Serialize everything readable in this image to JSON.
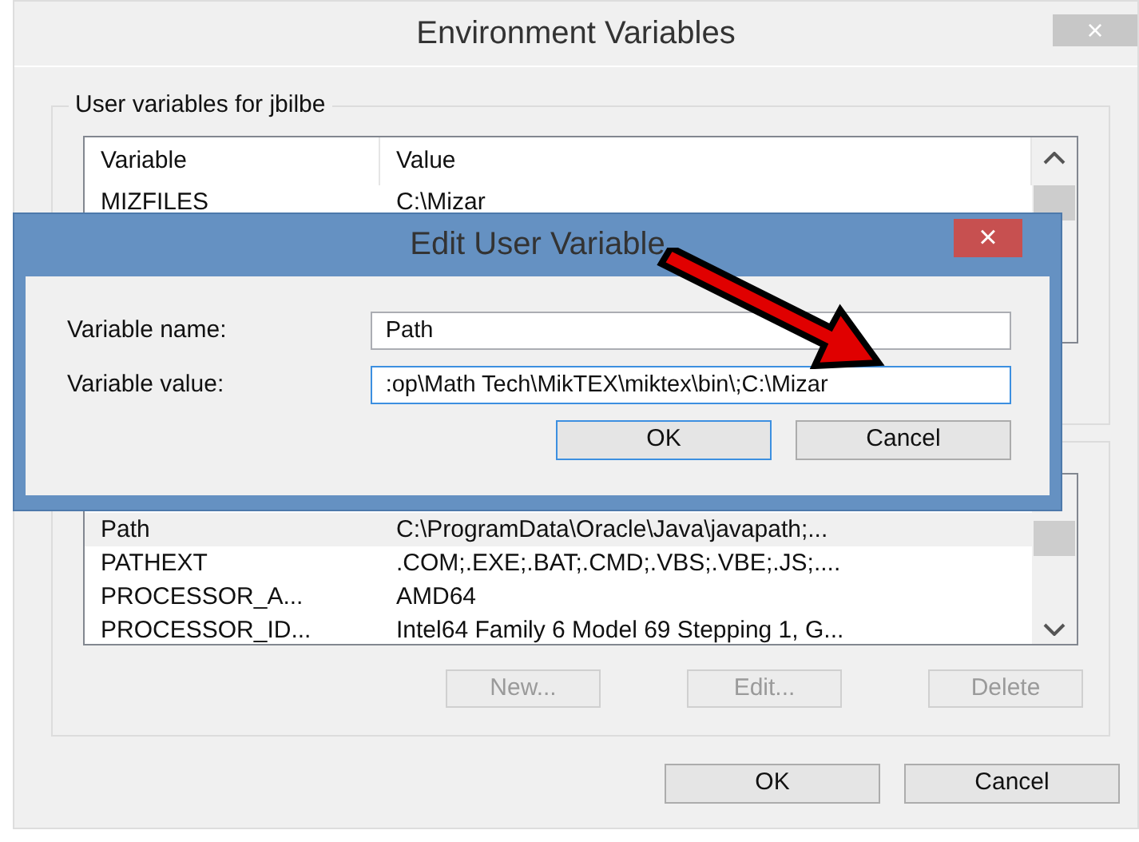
{
  "window": {
    "title": "Environment Variables",
    "close": "×"
  },
  "user_variables": {
    "label": "User variables for jbilbe",
    "columns": [
      "Variable",
      "Value"
    ],
    "rows": [
      {
        "variable": "MIZFILES",
        "value": "C:\\Mizar"
      }
    ]
  },
  "system_variables": {
    "rows": [
      {
        "variable": "Path",
        "value": "C:\\ProgramData\\Oracle\\Java\\javapath;...",
        "selected": true
      },
      {
        "variable": "PATHEXT",
        "value": ".COM;.EXE;.BAT;.CMD;.VBS;.VBE;.JS;....",
        "selected": false
      },
      {
        "variable": "PROCESSOR_A...",
        "value": "AMD64",
        "selected": false
      },
      {
        "variable": "PROCESSOR_ID...",
        "value": "Intel64 Family 6 Model 69 Stepping 1, G...",
        "selected": false
      }
    ],
    "buttons": [
      {
        "label": "New...",
        "disabled": true
      },
      {
        "label": "Edit...",
        "disabled": true
      },
      {
        "label": "Delete",
        "disabled": true
      }
    ]
  },
  "buttons": [
    {
      "label": "OK",
      "default": false
    },
    {
      "label": "Cancel",
      "default": false
    }
  ],
  "edit_dialog": {
    "title": "Edit User Variable",
    "close": "×",
    "fields": [
      {
        "label": "Variable name:",
        "value": "Path",
        "focused": false
      },
      {
        "label": "Variable value:",
        "value": ":op\\Math Tech\\MikTEX\\miktex\\bin\\;C:\\Mizar",
        "focused": true
      }
    ],
    "buttons": [
      {
        "label": "OK",
        "default": true
      },
      {
        "label": "Cancel",
        "default": false
      }
    ]
  }
}
